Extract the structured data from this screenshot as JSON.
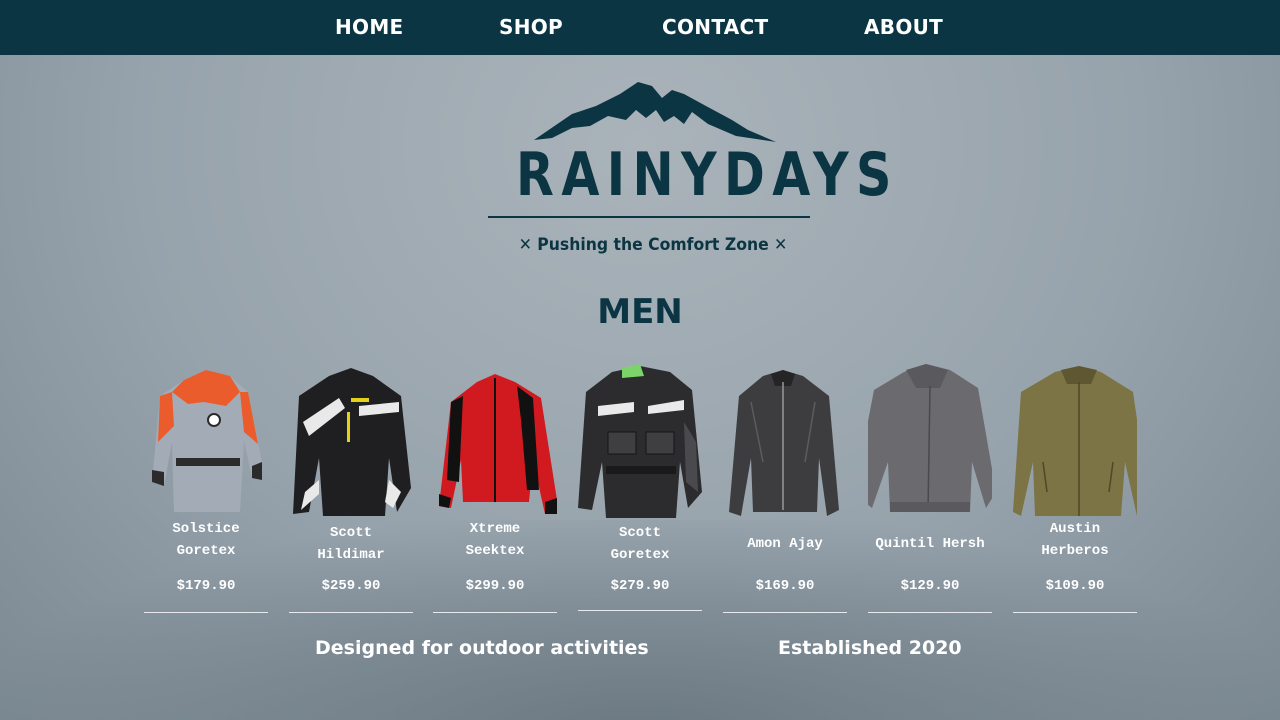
{
  "nav": {
    "items": [
      {
        "label": "HOME"
      },
      {
        "label": "SHOP"
      },
      {
        "label": "CONTACT"
      },
      {
        "label": "ABOUT"
      }
    ]
  },
  "logo": {
    "title": "RAINYDAYS",
    "tagline": "Pushing the Comfort Zone",
    "icon": "mountain-icon"
  },
  "section": {
    "title": "MEN"
  },
  "products": [
    {
      "name_line1": "Solstice",
      "name_line2": "Goretex",
      "price": "$179.90",
      "image": "orange-grey-jacket"
    },
    {
      "name_line1": "Scott",
      "name_line2": "Hildimar",
      "price": "$259.90",
      "image": "black-white-jacket"
    },
    {
      "name_line1": "Xtreme",
      "name_line2": "Seektex",
      "price": "$299.90",
      "image": "red-black-jacket"
    },
    {
      "name_line1": "Scott",
      "name_line2": "Goretex",
      "price": "$279.90",
      "image": "black-grey-jacket"
    },
    {
      "name_line1": "Amon Ajay",
      "name_line2": "",
      "price": "$169.90",
      "image": "dark-grey-jacket"
    },
    {
      "name_line1": "Quintil Hersh",
      "name_line2": "",
      "price": "$129.90",
      "image": "grey-bomber-jacket"
    },
    {
      "name_line1": "Austin",
      "name_line2": "Herberos",
      "price": "$109.90",
      "image": "olive-fleece-jacket"
    }
  ],
  "footer": {
    "left": "Designed for outdoor activities",
    "right": "Established 2020"
  },
  "colors": {
    "navbar": "#0b3542",
    "brand": "#0b3542",
    "text_light": "#ffffff"
  }
}
